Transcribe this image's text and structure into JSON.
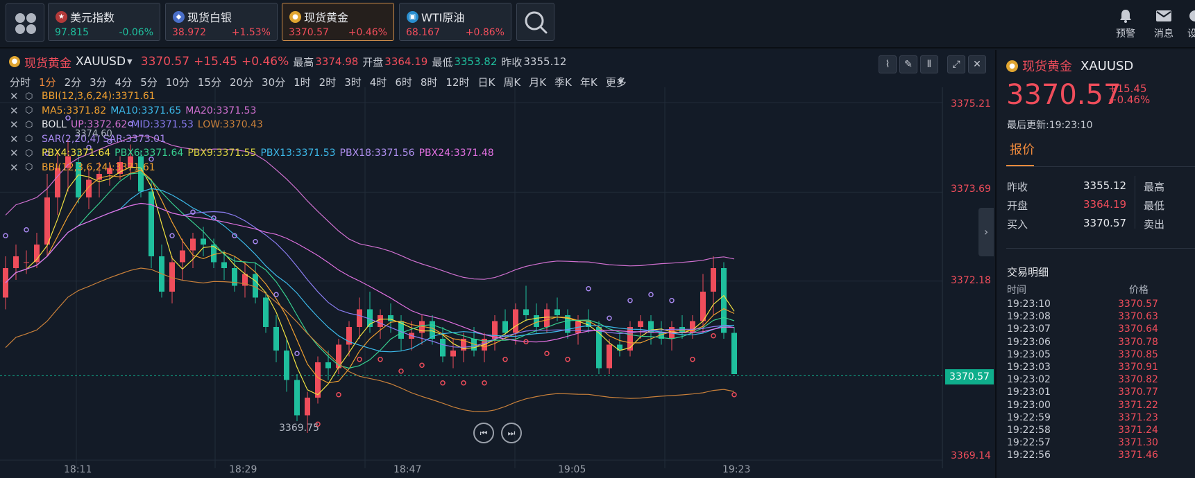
{
  "topbar": {
    "quotes": [
      {
        "name": "美元指数",
        "price": "97.815",
        "change": "-0.06%",
        "price_color": "#1fbf9d",
        "change_color": "#1fbf9d"
      },
      {
        "name": "现货白银",
        "price": "38.972",
        "change": "+1.53%",
        "price_color": "#ef4d5b",
        "change_color": "#ef4d5b"
      },
      {
        "name": "现货黄金",
        "price": "3370.57",
        "change": "+0.46%",
        "price_color": "#ef4d5b",
        "change_color": "#ef4d5b"
      },
      {
        "name": "WTI原油",
        "price": "68.167",
        "change": "+0.86%",
        "price_color": "#ef4d5b",
        "change_color": "#ef4d5b"
      }
    ],
    "alert_label": "预警",
    "message_label": "消息",
    "extra_label": "设"
  },
  "chart_header": {
    "name": "现货黄金",
    "symbol": "XAUUSD",
    "price": "3370.57",
    "change": "+15.45",
    "change_pct": "+0.46%",
    "high_label": "最高",
    "high": "3374.98",
    "open_label": "开盘",
    "open": "3364.19",
    "low_label": "最低",
    "low": "3353.82",
    "prev_label": "昨收",
    "prev": "3355.12"
  },
  "periods": [
    "分时",
    "1分",
    "2分",
    "3分",
    "4分",
    "5分",
    "10分",
    "15分",
    "20分",
    "30分",
    "1时",
    "2时",
    "3时",
    "4时",
    "6时",
    "8时",
    "12时",
    "日K",
    "周K",
    "月K",
    "季K",
    "年K",
    "更多"
  ],
  "active_period": "1分",
  "indicators": [
    {
      "items": [
        {
          "text": "BBI(12,3,6,24):3371.61",
          "color": "#f0a030"
        }
      ]
    },
    {
      "items": [
        {
          "text": "MA5:3371.82",
          "color": "#f0a030"
        },
        {
          "text": "MA10:3371.65",
          "color": "#3cb8e8"
        },
        {
          "text": "MA20:3371.53",
          "color": "#d070d0"
        }
      ]
    },
    {
      "items": [
        {
          "text": "BOLL",
          "color": "#e6e8ec"
        },
        {
          "text": "UP:3372.62",
          "color": "#d070d0"
        },
        {
          "text": "MID:3371.53",
          "color": "#8a7cf0"
        },
        {
          "text": "LOW:3370.43",
          "color": "#c9803a"
        }
      ]
    },
    {
      "items": [
        {
          "text": "SAR(2,20,4) SAR:3373.01",
          "color": "#a888f0"
        }
      ]
    },
    {
      "items": [
        {
          "text": "PBX4:3371.64",
          "color": "#f0e040"
        },
        {
          "text": "PBX6:3371.64",
          "color": "#38d090"
        },
        {
          "text": "PBX9:3371.55",
          "color": "#d8d040"
        },
        {
          "text": "PBX13:3371.53",
          "color": "#3cb8e8"
        },
        {
          "text": "PBX18:3371.56",
          "color": "#b090f0"
        },
        {
          "text": "PBX24:3371.48",
          "color": "#e070e0"
        }
      ]
    },
    {
      "items": [
        {
          "text": "BBI(12,3,6,24):3371.61",
          "color": "#f0a030"
        }
      ]
    }
  ],
  "chart_data": {
    "type": "candlestick",
    "y_ticks": [
      "3375.21",
      "3373.69",
      "3372.18",
      "3370.57",
      "3369.14"
    ],
    "ylim": [
      3369.0,
      3375.4
    ],
    "x_ticks": [
      "18:11",
      "18:29",
      "18:47",
      "19:05",
      "19:23"
    ],
    "last_price": "3370.57",
    "annotations": {
      "high_marker": "3374.60",
      "low_marker": "3369.75"
    },
    "candles_ohlc": [
      [
        3371.9,
        3372.6,
        3371.7,
        3372.4
      ],
      [
        3372.4,
        3372.8,
        3372.2,
        3372.6
      ],
      [
        3372.5,
        3372.7,
        3372.3,
        3372.5
      ],
      [
        3372.5,
        3373.0,
        3372.4,
        3372.8
      ],
      [
        3372.8,
        3374.0,
        3372.6,
        3373.6
      ],
      [
        3373.6,
        3374.4,
        3373.3,
        3374.1
      ],
      [
        3374.1,
        3374.6,
        3373.7,
        3374.3
      ],
      [
        3374.2,
        3374.4,
        3373.5,
        3373.6
      ],
      [
        3373.6,
        3374.1,
        3373.4,
        3373.9
      ],
      [
        3373.9,
        3374.2,
        3373.6,
        3374.0
      ],
      [
        3374.0,
        3374.2,
        3373.8,
        3374.1
      ],
      [
        3374.0,
        3374.3,
        3373.9,
        3374.2
      ],
      [
        3374.1,
        3374.5,
        3373.9,
        3374.3
      ],
      [
        3374.3,
        3374.4,
        3373.6,
        3373.7
      ],
      [
        3373.7,
        3373.9,
        3372.4,
        3372.6
      ],
      [
        3372.6,
        3372.8,
        3371.9,
        3372.0
      ],
      [
        3372.0,
        3372.6,
        3371.8,
        3372.5
      ],
      [
        3372.5,
        3372.9,
        3372.2,
        3372.7
      ],
      [
        3372.7,
        3373.0,
        3372.4,
        3372.9
      ],
      [
        3372.9,
        3373.1,
        3372.6,
        3372.8
      ],
      [
        3372.8,
        3372.9,
        3372.4,
        3372.5
      ],
      [
        3372.5,
        3372.7,
        3372.2,
        3372.4
      ],
      [
        3372.4,
        3372.6,
        3372.0,
        3372.1
      ],
      [
        3372.1,
        3372.5,
        3371.9,
        3372.3
      ],
      [
        3372.3,
        3372.5,
        3371.8,
        3371.9
      ],
      [
        3371.9,
        3372.0,
        3371.3,
        3371.4
      ],
      [
        3371.4,
        3371.6,
        3370.8,
        3371.0
      ],
      [
        3371.0,
        3371.2,
        3370.3,
        3370.5
      ],
      [
        3370.5,
        3370.6,
        3369.8,
        3369.9
      ],
      [
        3369.9,
        3370.3,
        3369.6,
        3370.2
      ],
      [
        3370.2,
        3370.9,
        3370.1,
        3370.8
      ],
      [
        3370.8,
        3371.0,
        3370.5,
        3370.7
      ],
      [
        3370.7,
        3371.2,
        3370.6,
        3371.1
      ],
      [
        3371.1,
        3371.5,
        3370.9,
        3371.4
      ],
      [
        3371.4,
        3371.9,
        3371.2,
        3371.7
      ],
      [
        3371.7,
        3372.0,
        3371.3,
        3371.4
      ],
      [
        3371.4,
        3371.7,
        3371.2,
        3371.6
      ],
      [
        3371.6,
        3371.8,
        3371.3,
        3371.5
      ],
      [
        3371.5,
        3371.6,
        3371.0,
        3371.2
      ],
      [
        3371.2,
        3371.5,
        3371.0,
        3371.3
      ],
      [
        3371.3,
        3371.6,
        3371.1,
        3371.5
      ],
      [
        3371.5,
        3371.6,
        3371.1,
        3371.2
      ],
      [
        3371.2,
        3371.4,
        3370.8,
        3370.9
      ],
      [
        3370.9,
        3371.2,
        3370.7,
        3371.0
      ],
      [
        3371.0,
        3371.3,
        3370.8,
        3371.2
      ],
      [
        3371.2,
        3371.4,
        3370.9,
        3371.0
      ],
      [
        3371.0,
        3371.3,
        3370.8,
        3371.2
      ],
      [
        3371.2,
        3371.6,
        3371.0,
        3371.5
      ],
      [
        3371.5,
        3371.7,
        3371.2,
        3371.3
      ],
      [
        3371.3,
        3371.8,
        3371.1,
        3371.7
      ],
      [
        3371.7,
        3372.1,
        3371.5,
        3371.6
      ],
      [
        3371.6,
        3371.8,
        3371.3,
        3371.4
      ],
      [
        3371.4,
        3371.8,
        3371.3,
        3371.7
      ],
      [
        3371.7,
        3371.9,
        3371.5,
        3371.6
      ],
      [
        3371.6,
        3371.7,
        3371.2,
        3371.3
      ],
      [
        3371.3,
        3371.6,
        3371.1,
        3371.5
      ],
      [
        3371.5,
        3371.7,
        3371.3,
        3371.4
      ],
      [
        3371.4,
        3371.5,
        3370.6,
        3370.7
      ],
      [
        3370.7,
        3371.2,
        3370.6,
        3371.1
      ],
      [
        3371.1,
        3371.3,
        3370.9,
        3371.0
      ],
      [
        3371.0,
        3371.5,
        3370.9,
        3371.4
      ],
      [
        3371.4,
        3371.6,
        3371.2,
        3371.5
      ],
      [
        3371.5,
        3371.6,
        3371.1,
        3371.3
      ],
      [
        3371.3,
        3371.5,
        3371.1,
        3371.2
      ],
      [
        3371.2,
        3371.5,
        3371.0,
        3371.4
      ],
      [
        3371.4,
        3371.6,
        3371.2,
        3371.3
      ],
      [
        3371.3,
        3371.6,
        3371.2,
        3371.5
      ],
      [
        3371.5,
        3372.3,
        3371.3,
        3372.0
      ],
      [
        3372.0,
        3372.6,
        3371.6,
        3372.4
      ],
      [
        3372.4,
        3372.5,
        3371.2,
        3371.3
      ],
      [
        3371.3,
        3371.4,
        3370.6,
        3370.6
      ]
    ]
  },
  "right_panel": {
    "name": "现货黄金",
    "symbol": "XAUUSD",
    "price": "3370.57",
    "change": "+15.45",
    "change_pct": "+0.46%",
    "updated_label": "最后更新:19:23:10",
    "tab": "报价",
    "stats": [
      {
        "label": "昨收",
        "value": "3355.12",
        "color": "#e6e8ec",
        "right": "最高"
      },
      {
        "label": "开盘",
        "value": "3364.19",
        "color": "#ef4d5b",
        "right": "最低"
      },
      {
        "label": "买入",
        "value": "3370.57",
        "color": "#e6e8ec",
        "right": "卖出"
      }
    ],
    "detail_title": "交易明细",
    "detail_time_header": "时间",
    "detail_price_header": "价格",
    "trades": [
      {
        "time": "19:23:10",
        "price": "3370.57"
      },
      {
        "time": "19:23:08",
        "price": "3370.63"
      },
      {
        "time": "19:23:07",
        "price": "3370.64"
      },
      {
        "time": "19:23:06",
        "price": "3370.78"
      },
      {
        "time": "19:23:05",
        "price": "3370.85"
      },
      {
        "time": "19:23:03",
        "price": "3370.91"
      },
      {
        "time": "19:23:02",
        "price": "3370.82"
      },
      {
        "time": "19:23:01",
        "price": "3370.77"
      },
      {
        "time": "19:23:00",
        "price": "3371.22"
      },
      {
        "time": "19:22:59",
        "price": "3371.23"
      },
      {
        "time": "19:22:58",
        "price": "3371.24"
      },
      {
        "time": "19:22:57",
        "price": "3371.30"
      },
      {
        "time": "19:22:56",
        "price": "3371.46"
      }
    ]
  }
}
